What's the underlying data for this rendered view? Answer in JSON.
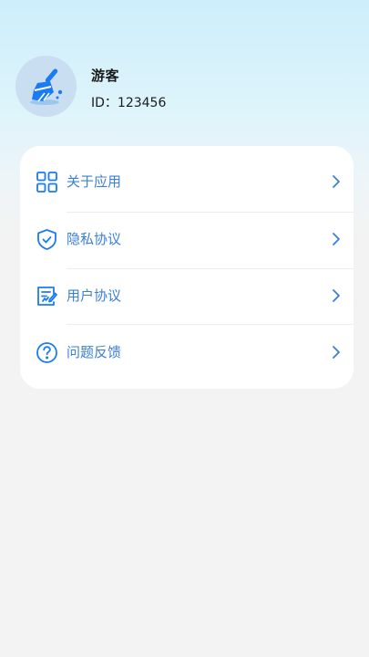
{
  "profile": {
    "username": "游客",
    "id_text": "ID：123456",
    "avatar_icon": "broom-icon"
  },
  "menu": {
    "items": [
      {
        "label": "关于应用",
        "icon": "grid-icon"
      },
      {
        "label": "隐私协议",
        "icon": "shield-check-icon"
      },
      {
        "label": "用户协议",
        "icon": "document-edit-icon"
      },
      {
        "label": "问题反馈",
        "icon": "question-circle-icon"
      }
    ]
  },
  "colors": {
    "accent": "#1a7cf0",
    "label": "#3a7fd9",
    "chevron": "#3a7fd9",
    "avatar_bg": "#c9def0"
  }
}
